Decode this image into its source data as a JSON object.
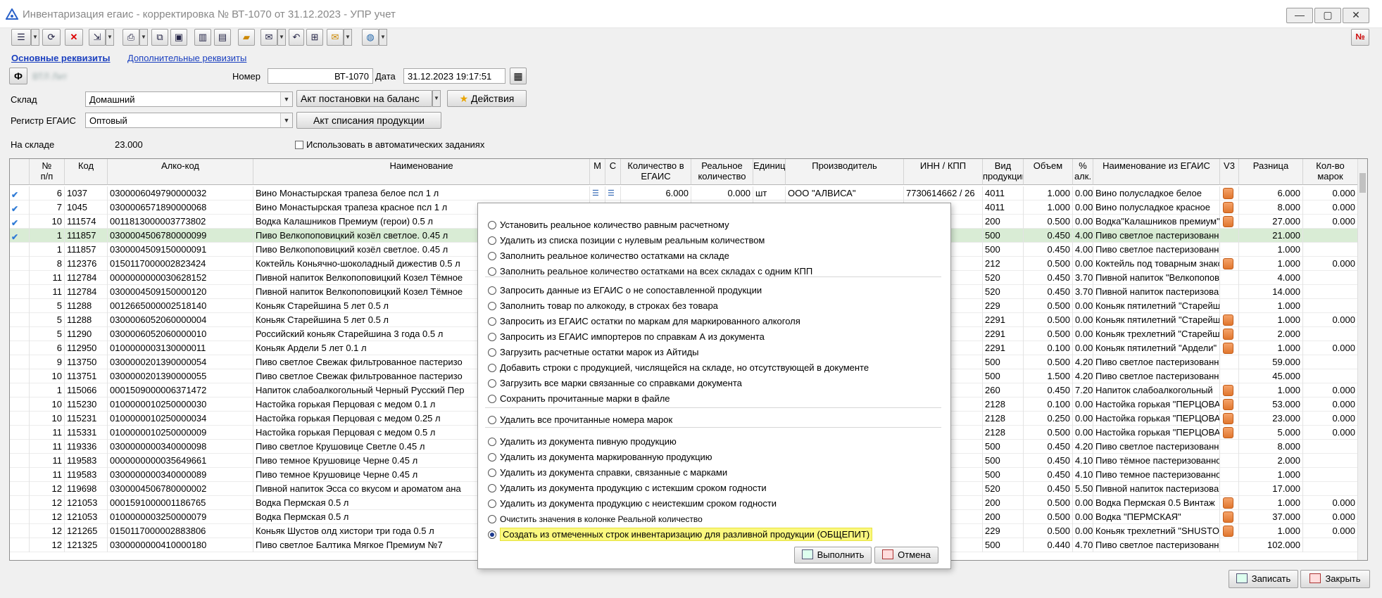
{
  "window": {
    "title": "Инвентаризация егаис - корректировка № ВТ-1070 от 31.12.2023 - УПР учет",
    "min": "—",
    "max": "▢",
    "close": "✕"
  },
  "toolbar": {
    "no_badge": "№"
  },
  "tabs": {
    "main": "Основные реквизиты",
    "extra": "Дополнительные реквизиты"
  },
  "form": {
    "org_btn": "Ф",
    "org_value": "ВТЛ Лит",
    "number_label": "Номер",
    "number_value": "ВТ-1070",
    "date_label": "Дата",
    "date_value": "31.12.2023 19:17:51",
    "warehouse_label": "Склад",
    "warehouse_value": "Домашний",
    "act_balance": "Акт постановки на баланс",
    "actions": "Действия",
    "register_label": "Регистр ЕГАИС",
    "register_value": "Оптовый",
    "act_writeoff": "Акт списания продукции",
    "stock_label": "На складе",
    "stock_value": "23.000",
    "auto_tasks": "Использовать в автоматических заданиях"
  },
  "grid": {
    "headers": {
      "np": "№\nп/п",
      "code": "Код",
      "alko": "Алко-код",
      "name": "Наименование",
      "m": "М",
      "c": "С",
      "qty_egais": "Количество в\nЕГАИС",
      "qty_real": "Реальное\nколичество",
      "unit": "Единица",
      "producer": "Производитель",
      "inn": "ИНН / КПП",
      "type": "Вид\nпродукции",
      "volume": "Объем",
      "pct": "%\nалк.",
      "egais_name": "Наименование из ЕГАИС",
      "v3": "V3",
      "diff": "Разница",
      "marks": "Кол-во\nмарок"
    },
    "rows": [
      {
        "chk": "✔",
        "np": "6",
        "code": "1037",
        "alko": "0300006049790000032",
        "name": "Вино Монастырская трапеза белое псл 1 л",
        "m": "☰",
        "c": "☰",
        "qe": "6.000",
        "qr": "0.000",
        "unit": "шт",
        "prod": "ООО \"АЛВИСА\"",
        "inn": "7730614662 / 26",
        "type": "4011",
        "vol": "1.000",
        "pct": "0.00",
        "en": "Вино полусладкое белое",
        "v3": true,
        "diff": "6.000",
        "marks": "0.000"
      },
      {
        "chk": "✔",
        "np": "7",
        "code": "1045",
        "alko": "0300006571890000068",
        "name": "Вино Монастырская трапеза красное псл 1 л",
        "m": "",
        "c": "",
        "qe": "",
        "qr": "",
        "unit": "",
        "prod": "",
        "inn": "/ 05",
        "type": "4011",
        "vol": "1.000",
        "pct": "0.00",
        "en": "Вино полусладкое красное",
        "v3": true,
        "diff": "8.000",
        "marks": "0.000"
      },
      {
        "chk": "✔",
        "np": "10",
        "code": "111574",
        "alko": "0011813000003773802",
        "name": "Водка Калашников Премиум (герои) 0.5 л",
        "m": "",
        "c": "",
        "qe": "",
        "qr": "",
        "unit": "",
        "prod": "",
        "inn": "/ 18",
        "type": "200",
        "vol": "0.500",
        "pct": "0.00",
        "en": "Водка\"Калашников премиум\"",
        "v3": true,
        "diff": "27.000",
        "marks": "0.000"
      },
      {
        "chk": "✔",
        "np": "1",
        "code": "111857",
        "alko": "0300004506780000099",
        "name": "Пиво Велкопоповицкий козёл светлое. 0.45 л",
        "m": "",
        "c": "",
        "qe": "",
        "qr": "",
        "unit": "",
        "prod": "",
        "inn": "/ 02",
        "type": "500",
        "vol": "0.450",
        "pct": "4.00",
        "en": "Пиво светлое пастеризованное",
        "v3": false,
        "diff": "21.000",
        "marks": "",
        "sel": true
      },
      {
        "chk": "",
        "np": "1",
        "code": "111857",
        "alko": "0300004509150000091",
        "name": "Пиво Велкопоповицкий козёл светлое. 0.45 л",
        "m": "",
        "c": "",
        "qe": "",
        "qr": "",
        "unit": "",
        "prod": "",
        "inn": "/ 54",
        "type": "500",
        "vol": "0.450",
        "pct": "4.00",
        "en": "Пиво светлое пастеризованное",
        "v3": false,
        "diff": "1.000",
        "marks": ""
      },
      {
        "chk": "",
        "np": "8",
        "code": "112376",
        "alko": "0150117000002823424",
        "name": "Коктейль Коньячно-шоколадный дижестив 0.5 л",
        "m": "",
        "c": "",
        "qe": "",
        "qr": "",
        "unit": "",
        "prod": "",
        "inn": "/ 50",
        "type": "212",
        "vol": "0.500",
        "pct": "0.00",
        "en": "Коктейль под товарным знаком",
        "v3": true,
        "diff": "1.000",
        "marks": "0.000"
      },
      {
        "chk": "",
        "np": "11",
        "code": "112784",
        "alko": "0000000000030628152",
        "name": "Пивной напиток Велкопоповицкий Козел Тёмное",
        "m": "",
        "c": "",
        "qe": "",
        "qr": "",
        "unit": "",
        "prod": "",
        "inn": "/ 40",
        "type": "520",
        "vol": "0.450",
        "pct": "3.70",
        "en": "Пивной напиток \"Велкопоповицкий",
        "v3": false,
        "diff": "4.000",
        "marks": ""
      },
      {
        "chk": "",
        "np": "11",
        "code": "112784",
        "alko": "0300004509150000120",
        "name": "Пивной напиток Велкопоповицкий Козел Тёмное",
        "m": "",
        "c": "",
        "qe": "",
        "qr": "",
        "unit": "",
        "prod": "",
        "inn": "/ 54",
        "type": "520",
        "vol": "0.450",
        "pct": "3.70",
        "en": "Пивной напиток пастеризованный",
        "v3": false,
        "diff": "14.000",
        "marks": ""
      },
      {
        "chk": "",
        "np": "5",
        "code": "11288",
        "alko": "0012665000002518140",
        "name": "Коньяк Старейшина 5 лет 0.5 л",
        "m": "",
        "c": "",
        "qe": "",
        "qr": "",
        "unit": "",
        "prod": "",
        "inn": "/ 26",
        "type": "229",
        "vol": "0.500",
        "pct": "0.00",
        "en": "Коньяк пятилетний \"Старейшина\"",
        "v3": false,
        "diff": "1.000",
        "marks": ""
      },
      {
        "chk": "",
        "np": "5",
        "code": "11288",
        "alko": "0300006052060000004",
        "name": "Коньяк Старейшина 5 лет 0.5 л",
        "m": "",
        "c": "",
        "qe": "",
        "qr": "",
        "unit": "",
        "prod": "",
        "inn": "/ 26",
        "type": "2291",
        "vol": "0.500",
        "pct": "0.00",
        "en": "Коньяк пятилетний \"Старейшина\"",
        "v3": true,
        "diff": "1.000",
        "marks": "0.000"
      },
      {
        "chk": "",
        "np": "5",
        "code": "11290",
        "alko": "0300006052060000010",
        "name": "Российский коньяк Старейшина 3 года 0.5 л",
        "m": "",
        "c": "",
        "qe": "",
        "qr": "",
        "unit": "",
        "prod": "",
        "inn": "/ 26",
        "type": "2291",
        "vol": "0.500",
        "pct": "0.00",
        "en": "Коньяк трехлетний \"Старейшина\"",
        "v3": true,
        "diff": "2.000",
        "marks": ""
      },
      {
        "chk": "",
        "np": "6",
        "code": "112950",
        "alko": "0100000003130000011",
        "name": "Коньяк Ардели 5 лет 0.1 л",
        "m": "",
        "c": "",
        "qe": "",
        "qr": "",
        "unit": "",
        "prod": "",
        "inn": "/ 59",
        "type": "2291",
        "vol": "0.100",
        "pct": "0.00",
        "en": "Коньяк пятилетний \"Ардели\"",
        "v3": true,
        "diff": "1.000",
        "marks": "0.000"
      },
      {
        "chk": "",
        "np": "9",
        "code": "113750",
        "alko": "0300000201390000054",
        "name": "Пиво светлое Свежак фильтрованное пастеризо",
        "m": "",
        "c": "",
        "qe": "",
        "qr": "",
        "unit": "",
        "prod": "",
        "inn": "/ 66",
        "type": "500",
        "vol": "0.500",
        "pct": "4.20",
        "en": "Пиво светлое пастеризованное",
        "v3": false,
        "diff": "59.000",
        "marks": ""
      },
      {
        "chk": "",
        "np": "10",
        "code": "113751",
        "alko": "0300000201390000055",
        "name": "Пиво светлое Свежак фильтрованное пастеризо",
        "m": "",
        "c": "",
        "qe": "",
        "qr": "",
        "unit": "",
        "prod": "",
        "inn": "/ 66",
        "type": "500",
        "vol": "1.500",
        "pct": "4.20",
        "en": "Пиво светлое пастеризованное",
        "v3": false,
        "diff": "45.000",
        "marks": ""
      },
      {
        "chk": "",
        "np": "1",
        "code": "115066",
        "alko": "0001509000006371472",
        "name": "Напиток слабоалкогольный Черный Русский Пер",
        "m": "",
        "c": "",
        "qe": "",
        "qr": "",
        "unit": "",
        "prod": "",
        "inn": "/ 50",
        "type": "260",
        "vol": "0.450",
        "pct": "7.20",
        "en": "Напиток слабоалкогольный",
        "v3": true,
        "diff": "1.000",
        "marks": "0.000"
      },
      {
        "chk": "",
        "np": "10",
        "code": "115230",
        "alko": "0100000010250000030",
        "name": "Настойка горькая Перцовая с медом 0.1 л",
        "m": "",
        "c": "",
        "qe": "",
        "qr": "",
        "unit": "",
        "prod": "",
        "inn": "/ 18",
        "type": "2128",
        "vol": "0.100",
        "pct": "0.00",
        "en": "Настойка горькая \"ПЕРЦОВАЯ",
        "v3": true,
        "diff": "53.000",
        "marks": "0.000"
      },
      {
        "chk": "",
        "np": "10",
        "code": "115231",
        "alko": "0100000010250000034",
        "name": "Настойка горькая Перцовая с медом 0.25 л",
        "m": "",
        "c": "",
        "qe": "",
        "qr": "",
        "unit": "",
        "prod": "",
        "inn": "/ 18",
        "type": "2128",
        "vol": "0.250",
        "pct": "0.00",
        "en": "Настойка горькая \"ПЕРЦОВАЯ",
        "v3": true,
        "diff": "23.000",
        "marks": "0.000"
      },
      {
        "chk": "",
        "np": "11",
        "code": "115331",
        "alko": "0100000010250000009",
        "name": "Настойка горькая Перцовая с медом 0.5 л",
        "m": "",
        "c": "",
        "qe": "",
        "qr": "",
        "unit": "",
        "prod": "",
        "inn": "/ 18",
        "type": "2128",
        "vol": "0.500",
        "pct": "0.00",
        "en": "Настойка горькая \"ПЕРЦОВАЯ",
        "v3": true,
        "diff": "5.000",
        "marks": "0.000"
      },
      {
        "chk": "",
        "np": "11",
        "code": "119336",
        "alko": "0300000000340000098",
        "name": "Пиво светлое Крушовице Светле 0.45 л",
        "m": "",
        "c": "",
        "qe": "",
        "qr": "",
        "unit": "",
        "prod": "",
        "inn": "/ 66",
        "type": "500",
        "vol": "0.450",
        "pct": "4.20",
        "en": "Пиво светлое пастеризованное",
        "v3": false,
        "diff": "8.000",
        "marks": ""
      },
      {
        "chk": "",
        "np": "11",
        "code": "119583",
        "alko": "0000000000035649661",
        "name": "Пиво темное Крушовице Черне 0.45 л",
        "m": "",
        "c": "",
        "qe": "",
        "qr": "",
        "unit": "",
        "prod": "",
        "inn": "/ 66",
        "type": "500",
        "vol": "0.450",
        "pct": "4.10",
        "en": "Пиво тёмное пастеризованное",
        "v3": false,
        "diff": "2.000",
        "marks": ""
      },
      {
        "chk": "",
        "np": "11",
        "code": "119583",
        "alko": "0300000000340000089",
        "name": "Пиво темное Крушовице Черне 0.45 л",
        "m": "",
        "c": "",
        "qe": "",
        "qr": "",
        "unit": "",
        "prod": "",
        "inn": "/ 66",
        "type": "500",
        "vol": "0.450",
        "pct": "4.10",
        "en": "Пиво темное пастеризованное",
        "v3": false,
        "diff": "1.000",
        "marks": ""
      },
      {
        "chk": "",
        "np": "12",
        "code": "119698",
        "alko": "0300004506780000002",
        "name": "Пивной напиток Эсса со вкусом и ароматом ана",
        "m": "",
        "c": "",
        "qe": "",
        "qr": "",
        "unit": "",
        "prod": "",
        "inn": "/ 02",
        "type": "520",
        "vol": "0.450",
        "pct": "5.50",
        "en": "Пивной напиток пастеризованный",
        "v3": false,
        "diff": "17.000",
        "marks": ""
      },
      {
        "chk": "",
        "np": "12",
        "code": "121053",
        "alko": "0001591000001186765",
        "name": "Водка Пермская 0.5 л",
        "m": "",
        "c": "",
        "qe": "",
        "qr": "",
        "unit": "",
        "prod": "",
        "inn": "/ 59",
        "type": "200",
        "vol": "0.500",
        "pct": "0.00",
        "en": "Водка Пермская 0.5 Винтаж",
        "v3": true,
        "diff": "1.000",
        "marks": "0.000"
      },
      {
        "chk": "",
        "np": "12",
        "code": "121053",
        "alko": "0100000003250000079",
        "name": "Водка Пермская 0.5 л",
        "m": "",
        "c": "",
        "qe": "",
        "qr": "",
        "unit": "",
        "prod": "",
        "inn": "/ 59",
        "type": "200",
        "vol": "0.500",
        "pct": "0.00",
        "en": "Водка \"ПЕРМСКАЯ\"",
        "v3": true,
        "diff": "37.000",
        "marks": "0.000"
      },
      {
        "chk": "",
        "np": "12",
        "code": "121265",
        "alko": "0150117000002883806",
        "name": "Коньяк Шустов олд хистори три года 0.5 л",
        "m": "",
        "c": "",
        "qe": "",
        "qr": "",
        "unit": "",
        "prod": "",
        "inn": "/ 50",
        "type": "229",
        "vol": "0.500",
        "pct": "0.00",
        "en": "Коньяк трехлетний \"SHUSTOFF",
        "v3": true,
        "diff": "1.000",
        "marks": "0.000"
      },
      {
        "chk": "",
        "np": "12",
        "code": "121325",
        "alko": "0300000000410000180",
        "name": "Пиво светлое Балтика Мягкое Премиум №7",
        "m": "",
        "c": "",
        "qe": "",
        "qr": "",
        "unit": "",
        "prod": "",
        "inn": "/ 54",
        "type": "500",
        "vol": "0.440",
        "pct": "4.70",
        "en": "Пиво светлое пастеризованное",
        "v3": false,
        "diff": "102.000",
        "marks": ""
      }
    ]
  },
  "popup": {
    "options": [
      "Установить реальное количество равным расчетному",
      "Удалить из списка позиции с нулевым реальным количеством",
      "Заполнить реальное количество остатками на складе",
      "Заполнить реальное количество остатками на всех складах с одним КПП",
      "Запросить данные из ЕГАИС о не сопоставленной продукции",
      "Заполнить товар по алкокоду, в строках без товара",
      "Запросить из ЕГАИС остатки по маркам для маркированного алкоголя",
      "Запросить из ЕГАИС импортеров по справкам А из документа",
      "Загрузить расчетные остатки марок из Айтиды",
      "Добавить строки с продукцией, числящейся на складе, но отсутствующей в документе",
      "Загрузить все марки связанные со справками документа",
      "Сохранить прочитанные марки в файле",
      "Удалить все прочитанные номера марок",
      "Удалить из документа пивную продукцию",
      "Удалить из документа маркированную продукцию",
      "Удалить из документа справки, связанные с марками",
      "Удалить из документа продукцию с истекшим сроком годности",
      "Удалить из документа продукцию с неистекшим сроком годности",
      "Очистить значения в колонке Реальной количество",
      "Создать из отмеченных строк инвентаризацию для разливной продукции (ОБЩЕПИТ)"
    ],
    "execute": "Выполнить",
    "cancel": "Отмена"
  },
  "footer": {
    "save": "Записать",
    "close": "Закрыть"
  },
  "colors": {
    "selected_row": "#d9ecd5",
    "highlight": "#fbf87e",
    "v3_marker": "#e88a45"
  }
}
